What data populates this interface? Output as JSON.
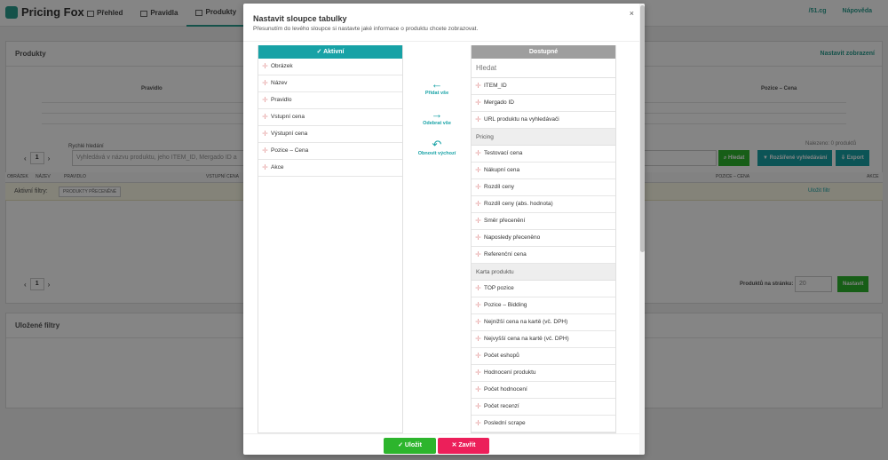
{
  "app": {
    "logo": "Pricing Fox",
    "nav": [
      {
        "label": "Přehled"
      },
      {
        "label": "Pravidla"
      },
      {
        "label": "Produkty",
        "active": true
      },
      {
        "label": "S"
      }
    ],
    "top_right": [
      "/51.cg",
      "Nápověda"
    ]
  },
  "products_panel": {
    "title": "Produkty",
    "settings_button": "Nastavit zobrazení",
    "col_pravidlo": "Pravidlo",
    "col_pozice": "Pozice – Cena",
    "quick_search_label": "Rychlé hledání",
    "search_placeholder": "Vyhledává v názvu produktu, jeho ITEM_ID, Mergado ID a",
    "found": "Nalezeno: 0 produktů",
    "btn_search": "Hledat",
    "btn_advanced": "Rozšířené vyhledávání",
    "btn_export": "Export",
    "page": "1",
    "table_headers": [
      "OBRÁZEK",
      "NÁZEV",
      "PRAVIDLO",
      "VSTUPNÍ CENA",
      "POZICE – CENA",
      "AKCE"
    ],
    "active_filters_label": "Aktivní filtry:",
    "filter_chip": "PRODUKTY PŘECENĚNÉ",
    "save_filter": "Uložit filtr",
    "per_page_label": "Produktů na stránku:",
    "per_page_value": "20",
    "btn_set": "Nastavit"
  },
  "saved_filters": {
    "title": "Uložené filtry"
  },
  "modal": {
    "title": "Nastavit sloupce tabulky",
    "subtitle": "Přesunutím do levého sloupce si nastavte jaké informace o produktu chcete zobrazovat.",
    "close_glyph": "×",
    "active_header": "Aktivní",
    "available_header": "Dostupné",
    "search_placeholder": "Hledat",
    "active_items": [
      "Obrázek",
      "Název",
      "Pravidlo",
      "Vstupní cena",
      "Výstupní cena",
      "Pozice – Cena",
      "Akce"
    ],
    "available_top": [
      "ITEM_ID",
      "Mergado ID",
      "URL produktu na vyhledávači"
    ],
    "group_pricing": "Pricing",
    "pricing_items": [
      "Testovací cena",
      "Nákupní cena",
      "Rozdíl ceny",
      "Rozdíl ceny (abs. hodnota)",
      "Směr přecenění",
      "Naposledy přeceněno",
      "Referenční cena"
    ],
    "group_karta": "Karta produktu",
    "karta_items": [
      "TOP pozice",
      "Pozice – Bidding",
      "Nejnižší cena na kartě (vč. DPH)",
      "Nejvyšší cena na kartě (vč. DPH)",
      "Počet eshopů",
      "Hodnocení produktu",
      "Počet hodnocení",
      "Počet recenzí",
      "Poslední scrape"
    ],
    "action_add": "Přidat vše",
    "action_remove": "Odebrat vše",
    "action_reset": "Obnovit výchozí",
    "save_label": "Uložit",
    "close_label": "Zavřít"
  },
  "colors": {
    "accent": "#17a2a6",
    "save": "#2db52d",
    "close": "#ec1f5a"
  }
}
